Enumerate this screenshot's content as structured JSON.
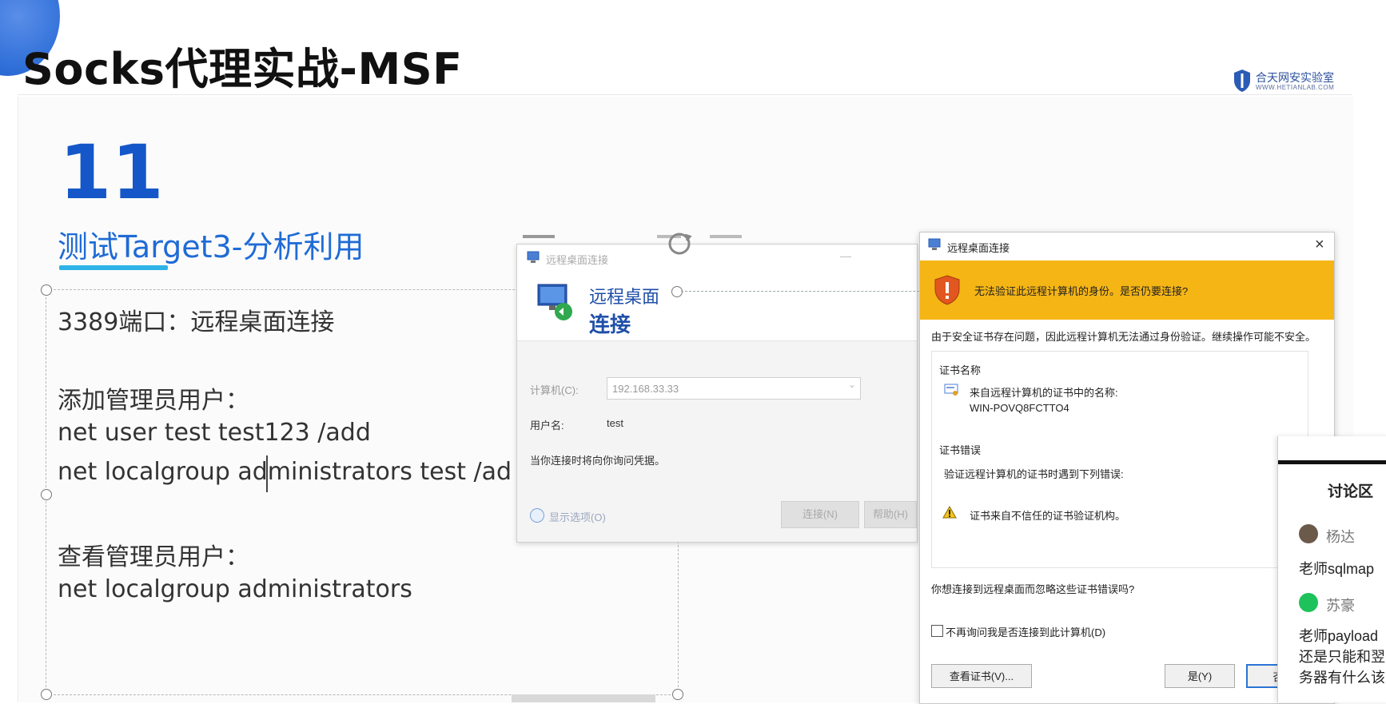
{
  "slide": {
    "title": "Socks代理实战-MSF",
    "logo_text": "合天网安实验室",
    "logo_sub": "WWW.HETIANLAB.COM",
    "number": "11",
    "subtitle": "测试Target3-分析利用",
    "lines": [
      "3389端口：远程桌面连接",
      "添加管理员用户：",
      "net user test test123 /add",
      "net localgroup administrators test /ad",
      "查看管理员用户：",
      "net localgroup administrators"
    ]
  },
  "rdp_window": {
    "title": "远程桌面连接",
    "heading1": "远程桌面",
    "heading2": "连接",
    "computer_label": "计算机(C):",
    "computer_value": "192.168.33.33",
    "username_label": "用户名:",
    "username_value": "test",
    "note": "当你连接时将向你询问凭据。",
    "show_options": "显示选项(O)",
    "connect_button": "连接(N)",
    "help_button": "帮助(H)"
  },
  "cert_dialog": {
    "title": "远程桌面连接",
    "warning": "无法验证此远程计算机的身份。是否仍要连接?",
    "description": "由于安全证书存在问题，因此远程计算机无法通过身份验证。继续操作可能不安全。",
    "cert_name_heading": "证书名称",
    "cert_name_label": "来自远程计算机的证书中的名称:",
    "cert_name_value": "WIN-POVQ8FCTTO4",
    "cert_errors_heading": "证书错误",
    "cert_errors_label": "验证远程计算机的证书时遇到下列错误:",
    "cert_error_item": "证书来自不信任的证书验证机构。",
    "question": "你想连接到远程桌面而忽略这些证书错误吗?",
    "checkbox_label": "不再询问我是否连接到此计算机(D)",
    "view_cert_button": "查看证书(V)...",
    "yes_button": "是(Y)",
    "no_button": "否"
  },
  "discussion": {
    "title": "讨论区",
    "messages": [
      {
        "name": "杨达",
        "text": "老师sqlmap"
      },
      {
        "name": "苏豪",
        "text": "老师payload",
        "extra": [
          "还是只能和翌",
          "务器有什么该"
        ]
      }
    ]
  },
  "colors": {
    "accent_blue": "#1557c9",
    "warning_band": "#f5b515",
    "underline": "#2fb3e6"
  }
}
